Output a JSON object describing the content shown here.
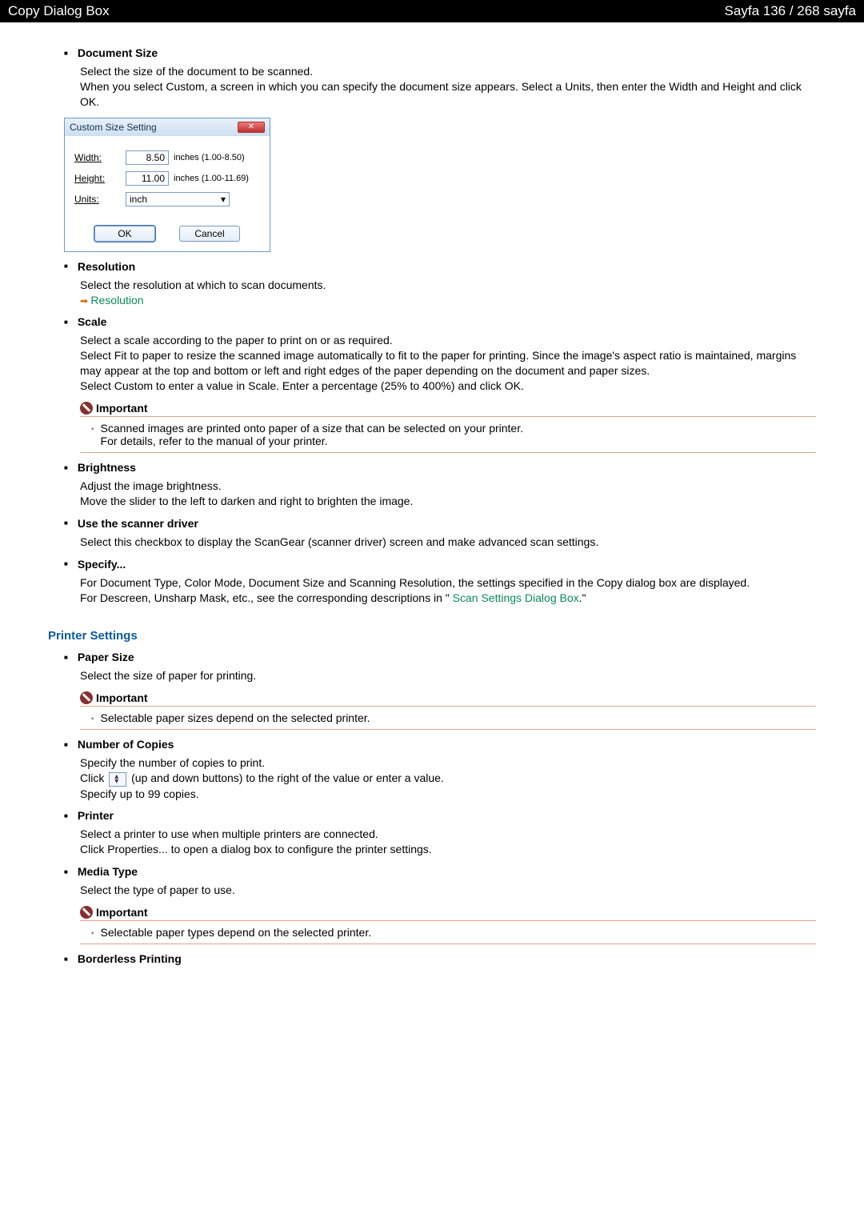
{
  "header": {
    "left": "Copy Dialog Box",
    "right": "Sayfa 136 / 268 sayfa"
  },
  "docSize": {
    "title": "Document Size",
    "p1": "Select the size of the document to be scanned.",
    "p2": "When you select Custom, a screen in which you can specify the document size appears. Select a Units, then enter the Width and Height and click OK."
  },
  "dialog": {
    "title": "Custom Size Setting",
    "width_l": "Width:",
    "width_v": "8.50",
    "width_r": "inches (1.00-8.50)",
    "height_l": "Height:",
    "height_v": "11.00",
    "height_r": "inches (1.00-11.69)",
    "units_l": "Units:",
    "units_v": "inch",
    "ok": "OK",
    "cancel": "Cancel"
  },
  "resolution": {
    "title": "Resolution",
    "p1": "Select the resolution at which to scan documents.",
    "link": "Resolution"
  },
  "scale": {
    "title": "Scale",
    "p1": "Select a scale according to the paper to print on or as required.",
    "p2": "Select Fit to paper to resize the scanned image automatically to fit to the paper for printing. Since the image's aspect ratio is maintained, margins may appear at the top and bottom or left and right edges of the paper depending on the document and paper sizes.",
    "p3": "Select Custom to enter a value in Scale. Enter a percentage (25% to 400%) and click OK.",
    "imp_t": "Important",
    "imp_b1": "Scanned images are printed onto paper of a size that can be selected on your printer.",
    "imp_b2": "For details, refer to the manual of your printer."
  },
  "brightness": {
    "title": "Brightness",
    "p1": "Adjust the image brightness.",
    "p2": "Move the slider to the left to darken and right to brighten the image."
  },
  "driver": {
    "title": "Use the scanner driver",
    "p1": "Select this checkbox to display the ScanGear (scanner driver) screen and make advanced scan settings."
  },
  "specify": {
    "title": "Specify...",
    "p1": "For Document Type, Color Mode, Document Size and Scanning Resolution, the settings specified in the Copy dialog box are displayed.",
    "p2a": "For Descreen, Unsharp Mask, etc., see the corresponding descriptions in \" ",
    "link": "Scan Settings Dialog Box",
    "p2b": ".\""
  },
  "printer": {
    "heading": "Printer Settings",
    "paperSize": {
      "title": "Paper Size",
      "p1": "Select the size of paper for printing.",
      "imp_t": "Important",
      "imp_b": "Selectable paper sizes depend on the selected printer."
    },
    "copies": {
      "title": "Number of Copies",
      "p1": "Specify the number of copies to print.",
      "p2a": "Click ",
      "p2b": " (up and down buttons) to the right of the value or enter a value.",
      "p3": "Specify up to 99 copies."
    },
    "printer": {
      "title": "Printer",
      "p1": "Select a printer to use when multiple printers are connected.",
      "p2": "Click Properties... to open a dialog box to configure the printer settings."
    },
    "media": {
      "title": "Media Type",
      "p1": "Select the type of paper to use.",
      "imp_t": "Important",
      "imp_b": "Selectable paper types depend on the selected printer."
    },
    "borderless": {
      "title": "Borderless Printing"
    }
  }
}
